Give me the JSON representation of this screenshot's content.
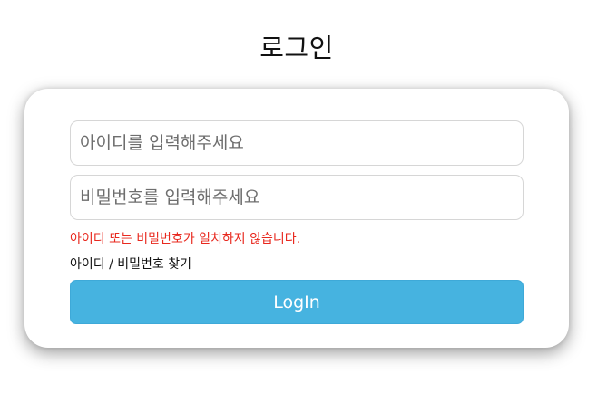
{
  "header": {
    "title": "로그인"
  },
  "form": {
    "id_placeholder": "아이디를 입력해주세요",
    "id_value": "",
    "password_placeholder": "비밀번호를 입력해주세요",
    "password_value": "",
    "error_message": "아이디 또는 비밀번호가 일치하지 않습니다.",
    "find_link_label": "아이디 / 비밀번호 찾기",
    "login_button_label": "LogIn"
  },
  "colors": {
    "error": "#e8281e",
    "button_background": "#46b3e0",
    "button_text": "#ffffff",
    "field_border": "#d6d6d6"
  }
}
